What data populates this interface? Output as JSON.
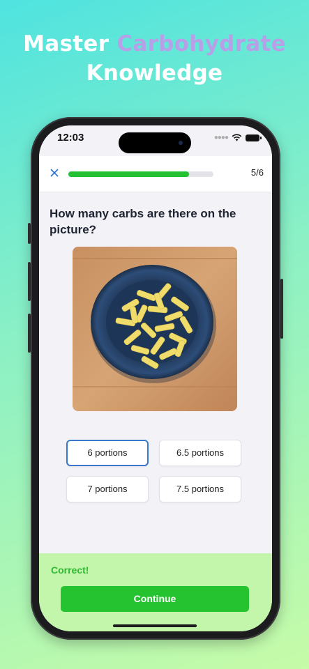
{
  "headline": {
    "word1": "Master",
    "word2": "Carbohydrate",
    "line2": "Knowledge",
    "accent_color": "#b8a0e8"
  },
  "status_bar": {
    "time": "12:03",
    "icons": [
      "signal-icon",
      "wifi-icon",
      "battery-icon"
    ]
  },
  "quiz": {
    "close_icon": "close-icon",
    "progress_value": 0.833,
    "progress_text": "5/6",
    "progress_color": "#23c033",
    "question": "How many carbs are there on the picture?",
    "image_subject": "plate of penne pasta"
  },
  "options": [
    {
      "label": "6 portions",
      "selected": true
    },
    {
      "label": "6.5 portions",
      "selected": false
    },
    {
      "label": "7 portions",
      "selected": false
    },
    {
      "label": "7.5 portions",
      "selected": false
    }
  ],
  "feedback": {
    "status": "Correct!",
    "button": "Continue",
    "status_color": "#2fba33",
    "button_color": "#25c330"
  }
}
